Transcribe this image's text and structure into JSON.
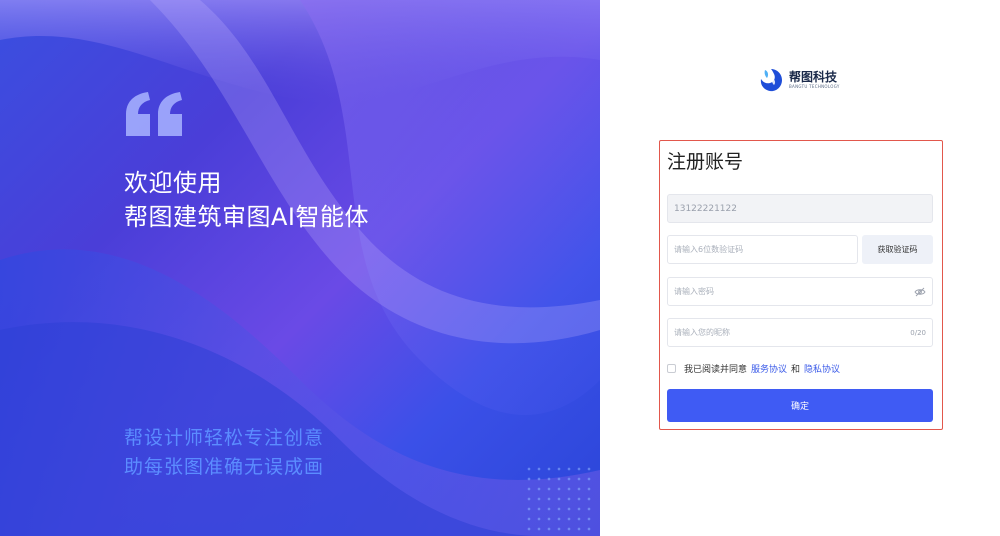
{
  "hero": {
    "title_line1": "欢迎使用",
    "title_line2": "帮图建筑审图AI智能体",
    "slogan_line1": "帮设计师轻松专注创意",
    "slogan_line2": "助每张图准确无误成画"
  },
  "brand": {
    "name_cn": "帮图科技",
    "name_en": "BANGTU TECHNOLOGY",
    "accent": "#3f5bf4"
  },
  "form": {
    "title": "注册账号",
    "phone_value": "13122221122",
    "code_placeholder": "请输入6位数验证码",
    "get_code_label": "获取验证码",
    "password_placeholder": "请输入密码",
    "nickname_placeholder": "请输入您的昵称",
    "nickname_counter": "0/20",
    "agree_prefix": "我已阅读并同意",
    "service_link": "服务协议",
    "agree_and": "和",
    "privacy_link": "隐私协议",
    "submit_label": "确定"
  },
  "icons": {
    "quote": "quote-icon",
    "eye": "eye-off-icon",
    "logo": "bangtu-logo-icon"
  }
}
